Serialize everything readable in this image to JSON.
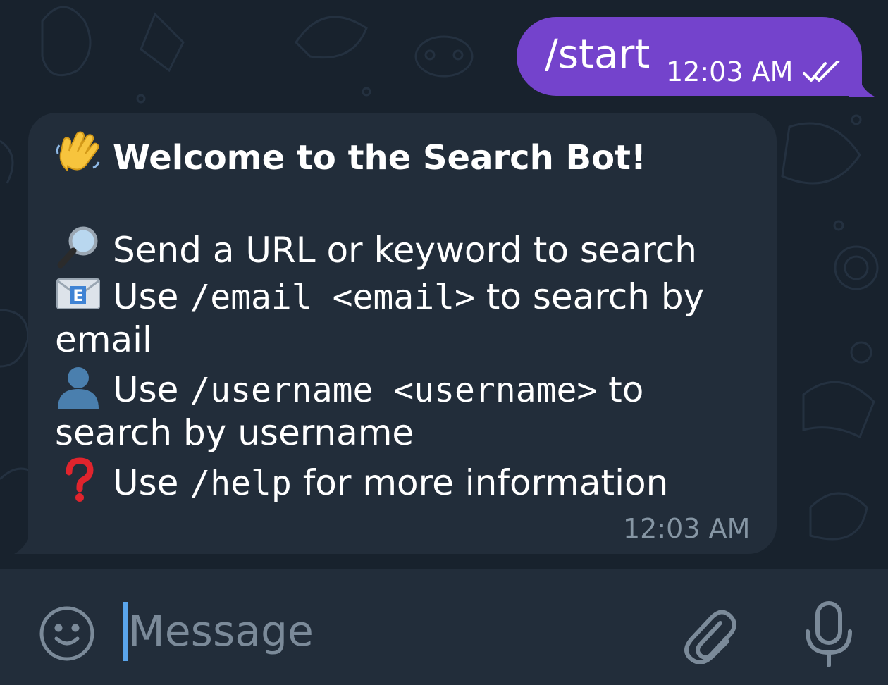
{
  "conversation": {
    "outgoing": {
      "text": "/start",
      "time": "12:03 AM",
      "status_icon": "double-check-icon"
    },
    "incoming": {
      "title": "Welcome to the Search Bot!",
      "lines": [
        {
          "emoji": "waving-hand-icon",
          "text": "Send a URL or keyword to search"
        },
        {
          "emoji": "magnifier-icon",
          "pre": "Use ",
          "code": "/email <email>",
          "post": " to search by",
          "cont": "email"
        },
        {
          "emoji": "user-silhouette-icon",
          "pre": "Use ",
          "code": "/username <username>",
          "post": " to",
          "cont": "search by username"
        },
        {
          "emoji": "red-question-icon",
          "pre": "Use ",
          "code": "/help",
          "post": " for more information"
        }
      ],
      "time": "12:03 AM"
    }
  },
  "input_bar": {
    "placeholder": "Message",
    "value": ""
  },
  "colors": {
    "background": "#18222d",
    "outgoing_bubble": "#7443cc",
    "incoming_bubble": "#222d3a",
    "input_bar": "#222d3a",
    "caret": "#5aa5ec",
    "muted_text": "#8696a4"
  }
}
